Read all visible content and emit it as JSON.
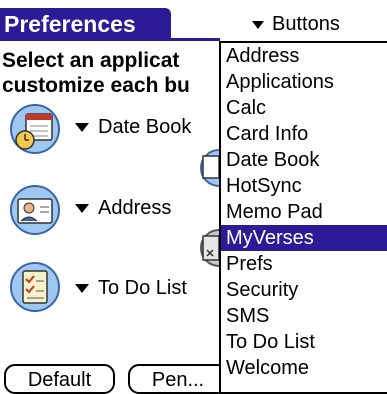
{
  "header": {
    "title": "Preferences",
    "category_label": "Buttons"
  },
  "instructions": {
    "line1": "Select an applicat",
    "line2": "customize each bu"
  },
  "buttons": [
    {
      "label": "Date Book",
      "icon": "date-book-icon"
    },
    {
      "label": "Address",
      "icon": "address-icon"
    },
    {
      "label": "To Do List",
      "icon": "todo-list-icon"
    }
  ],
  "footer": {
    "default_label": "Default",
    "pen_label": "Pen..."
  },
  "app_list": {
    "items": [
      "Address",
      "Applications",
      "Calc",
      "Card Info",
      "Date Book",
      "HotSync",
      "Memo Pad",
      "MyVerses",
      "Prefs",
      "Security",
      "SMS",
      "To Do List",
      "Welcome"
    ],
    "selected": "MyVerses"
  },
  "colors": {
    "accent": "#2c1a96"
  }
}
